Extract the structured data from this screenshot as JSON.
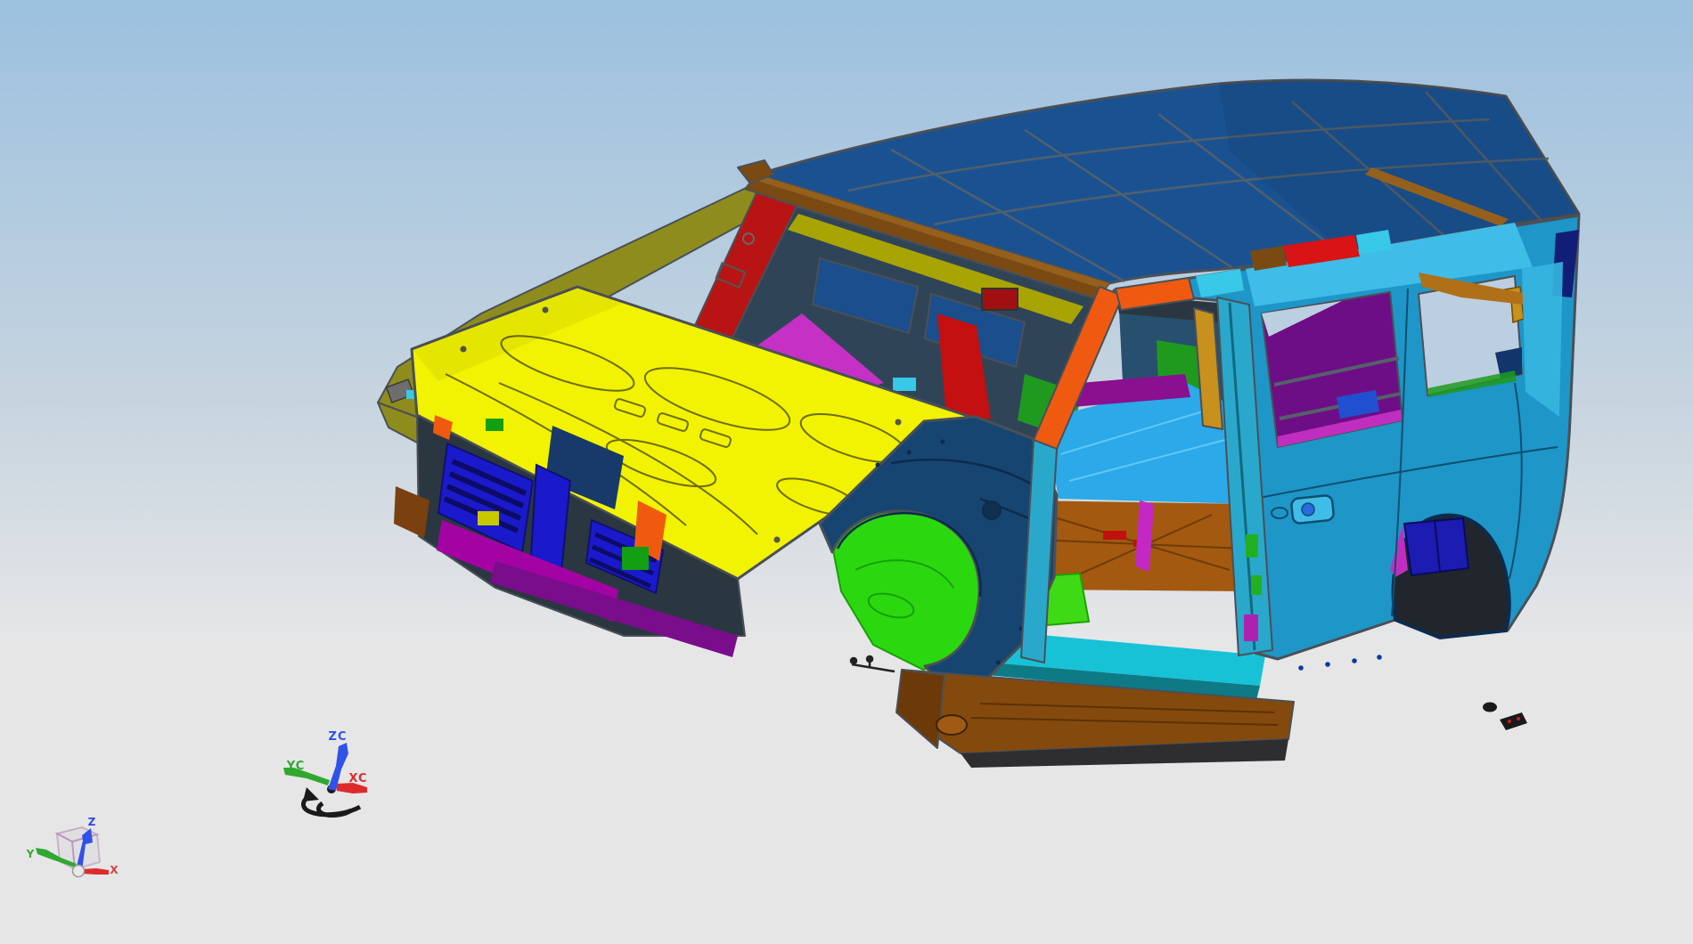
{
  "viewport": {
    "kind": "3D CAD model viewport",
    "model_subject": "automotive body-in-white assembly"
  },
  "wcs_triad": {
    "z_label": "ZC",
    "y_label": "YC",
    "x_label": "XC"
  },
  "view_triad": {
    "z_label": "Z",
    "y_label": "Y",
    "x_label": "X"
  },
  "parts": [
    {
      "name": "roof-panel",
      "color": "#1A5291"
    },
    {
      "name": "windshield-header",
      "color": "#7A4A12"
    },
    {
      "name": "hood-panel",
      "color": "#F2F203"
    },
    {
      "name": "far-fender-rail",
      "color": "#8F8C1E"
    },
    {
      "name": "far-a-pillar",
      "color": "#B81414"
    },
    {
      "name": "cowl-top",
      "color": "#C431C4"
    },
    {
      "name": "cowl-bar",
      "color": "#8A10A0"
    },
    {
      "name": "radiator-support",
      "color": "#1A1ACC"
    },
    {
      "name": "bumper-bar",
      "color": "#A303A3"
    },
    {
      "name": "near-a-pillar",
      "color": "#F05A10"
    },
    {
      "name": "front-fender",
      "color": "#164571"
    },
    {
      "name": "wheelhouse-splash",
      "color": "#2BD80F"
    },
    {
      "name": "front-floor-pan",
      "color": "#3EDA16"
    },
    {
      "name": "mid-floor-pan",
      "color": "#A3590F"
    },
    {
      "name": "rear-floor",
      "color": "#2BA9E8"
    },
    {
      "name": "sill-inner",
      "color": "#18C2D6"
    },
    {
      "name": "rocker-sill",
      "color": "#84490D"
    },
    {
      "name": "b-pillar",
      "color": "#2AA8CC"
    },
    {
      "name": "body-side-outer",
      "color": "#1E96C8"
    },
    {
      "name": "quarter-trim",
      "color": "#6E0E86"
    },
    {
      "name": "rear-wheelhouse",
      "color": "#1C1CB2"
    },
    {
      "name": "roof-rail-reinforcement",
      "color": "#D81414"
    }
  ],
  "colors": {
    "bg_top": "#9CC0DF",
    "bg_mid": "#C6D4DF",
    "bg_bottom": "#E6E6E7",
    "outline": "#4A5057",
    "roofline": "#56606B",
    "roof": "#1A5291",
    "roof_dark": "#124172",
    "header_brown": "#7A4A12",
    "header_hi": "#95601C",
    "pillar_red": "#B81414",
    "pillar_brown": "#A05818",
    "fender_olive": "#8F8C1E",
    "header_olive": "#A8A404",
    "interior_dark": "#2F4557",
    "interior_mid": "#27506E",
    "visor_blue": "#1A4E8C",
    "engine_navy": "#173A6B",
    "duct_red": "#C41010",
    "cowl_magenta": "#C431C4",
    "cowl_purple": "#8A10A0",
    "hood_yellow": "#F2F203",
    "hood_line": "#6E6E00",
    "grille_blue": "#1A1ACC",
    "slat_dark": "#0C0C66",
    "bumper_magenta": "#A303A3",
    "bumper_purple": "#7A0D8C",
    "accent_orange": "#F05A10",
    "wedge_brown": "#7A4010",
    "green_small": "#12A012",
    "seat_green": "#1F9A1F",
    "fender_navy": "#164571",
    "fender_line": "#0E2B4C",
    "arch_green": "#2BD80F",
    "floor_green": "#3EDA16",
    "floor_blue": "#2BA9E8",
    "floor_brown": "#A3590F",
    "floor_brown_line": "#6E3C08",
    "sill_cyan": "#18C2D6",
    "sill_teal": "#0E7A86",
    "rocker_brown": "#84490D",
    "rocker_cap": "#6B3A08",
    "rocker_dark": "#2E2E30",
    "knob_brown": "#A05A14",
    "pillar_cyan": "#2AA8CC",
    "bar_amber": "#C8901C",
    "clip_green": "#22B022",
    "clip_magenta": "#C428C4",
    "clip_purple": "#B020B0",
    "bodyside": "#1E96C8",
    "bodyside_hi": "#3FBCE8",
    "dpillar": "#35B6E0",
    "quarter_purple": "#6E0E86",
    "far_magenta": "#8A1090",
    "strip_magenta": "#C02EC0",
    "rail_red": "#D81414",
    "rail_cyan": "#38C8E8",
    "rail_tan": "#B07018",
    "qtr_navy": "#12366B",
    "corner_navy": "#101E78",
    "wheelwell_blue": "#1C1CB2",
    "sky_through": "#BCCFE0",
    "shadow_dark": "#2B3740",
    "window_blue": "#2050D0",
    "handle_blue": "#2A6AE0",
    "dot_blue": "#0A3C9C",
    "debris": "#1A1A1C",
    "debris_red": "#C02020",
    "axis_blue": "#2F52E8",
    "axis_green": "#2FA82F",
    "axis_red": "#DD2B2B",
    "cube_edge": "#B288B2",
    "cube_face": "#DCDCDE",
    "label_blue": "#3048E0",
    "label_green": "#38A838",
    "label_red": "#D84040",
    "ink": "#1A1A1A",
    "sphere": "#E8E8E8"
  }
}
